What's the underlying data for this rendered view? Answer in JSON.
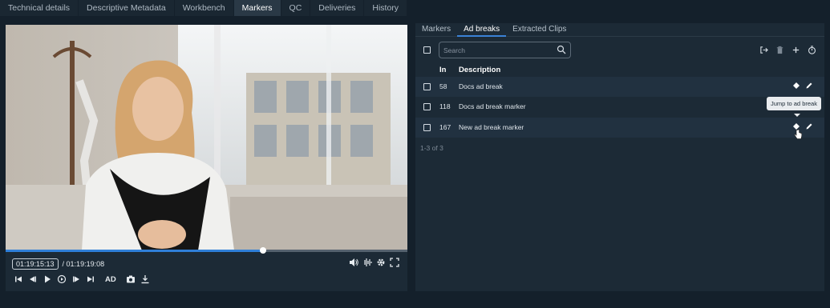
{
  "top_tabs": [
    "Technical details",
    "Descriptive Metadata",
    "Workbench",
    "Markers",
    "QC",
    "Deliveries",
    "History"
  ],
  "active_top_tab": "Markers",
  "player": {
    "current_timecode": "01:19:15:13",
    "total_timecode": "/ 01:19:19:08",
    "progress": 0.64,
    "ad_label": "AD",
    "icons": [
      "volume-icon",
      "audio-waveform-icon",
      "settings-gear-icon",
      "fullscreen-icon",
      "skip-start-icon",
      "step-back-icon",
      "play-icon",
      "loop-icon",
      "step-forward-icon",
      "skip-end-icon",
      "camera-icon",
      "download-icon"
    ]
  },
  "panel": {
    "subtabs": [
      "Markers",
      "Ad breaks",
      "Extracted Clips"
    ],
    "active_subtab": "Ad breaks",
    "search_placeholder": "Search",
    "toolbar_icons": [
      "export-icon",
      "delete-icon",
      "add-icon",
      "timer-icon"
    ],
    "columns": {
      "in": "In",
      "description": "Description"
    },
    "rows": [
      {
        "in": "58",
        "description": "Docs ad break"
      },
      {
        "in": "118",
        "description": "Docs ad break marker"
      },
      {
        "in": "167",
        "description": "New ad break marker"
      }
    ],
    "pager": "1-3 of 3",
    "tooltip": "Jump to ad break"
  },
  "colors": {
    "accent": "#3b82d6",
    "background": "#14202b",
    "panel": "#1c2a36"
  }
}
